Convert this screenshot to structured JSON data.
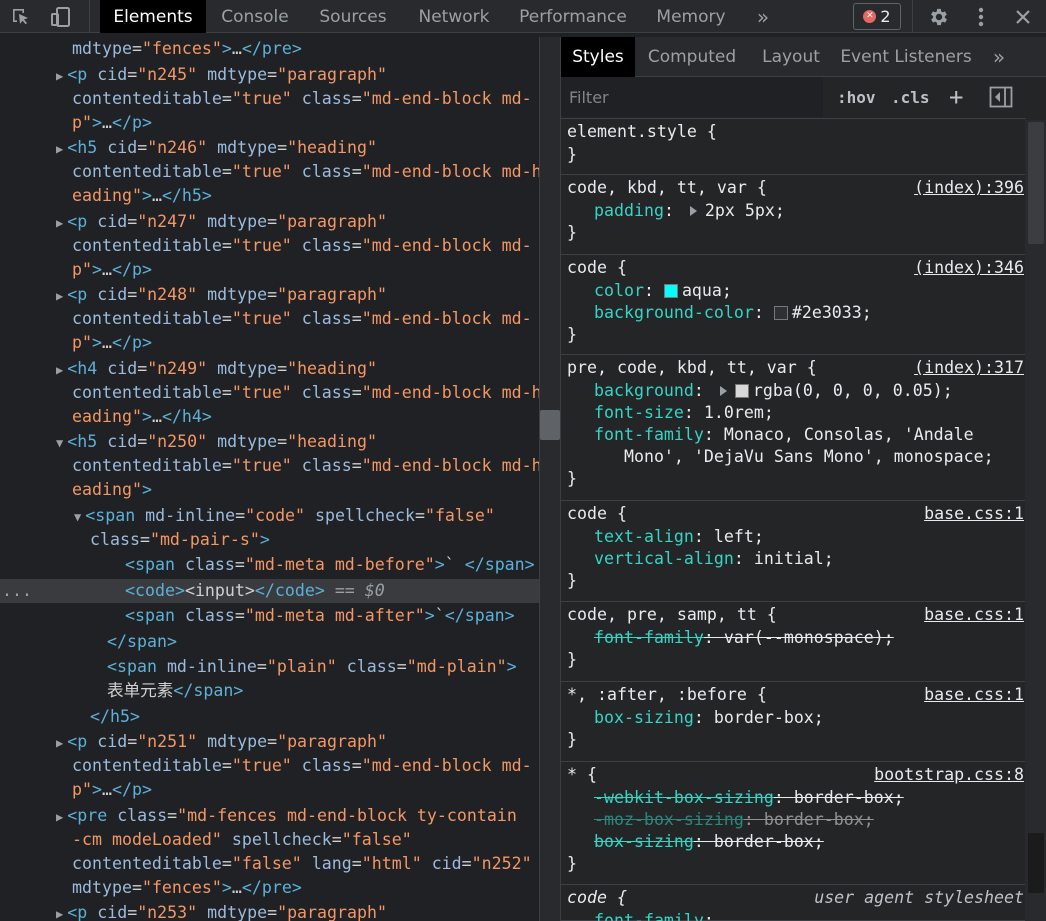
{
  "toolbar": {
    "tabs": [
      "Elements",
      "Console",
      "Sources",
      "Network",
      "Performance",
      "Memory"
    ],
    "more": "»",
    "error_count": "2",
    "icons": [
      "select-element-icon",
      "device-toolbar-icon",
      "gear-icon",
      "kebab-menu-icon",
      "close-icon"
    ]
  },
  "dom_lines": [
    [
      [
        "attr",
        "mdtype"
      ],
      [
        "txt",
        "="
      ],
      [
        "val",
        "\"fences\""
      ],
      [
        "tag",
        ">"
      ],
      [
        "txt",
        "…"
      ],
      [
        "tag",
        "</pre>"
      ]
    ],
    [
      [
        "tri",
        "▶"
      ],
      [
        "tag",
        "<p"
      ],
      [
        "attr",
        " cid"
      ],
      [
        "txt",
        "="
      ],
      [
        "val",
        "\"n245\""
      ],
      [
        "attr",
        " mdtype"
      ],
      [
        "txt",
        "="
      ],
      [
        "val",
        "\"paragraph\""
      ]
    ],
    [
      [
        "attr",
        "contenteditable"
      ],
      [
        "txt",
        "="
      ],
      [
        "val",
        "\"true\""
      ],
      [
        "attr",
        " class"
      ],
      [
        "txt",
        "="
      ],
      [
        "val",
        "\"md-end-block md-"
      ]
    ],
    [
      [
        "val",
        "p\""
      ],
      [
        "tag",
        ">"
      ],
      [
        "txt",
        "…"
      ],
      [
        "tag",
        "</p>"
      ]
    ],
    [
      [
        "tri",
        "▶"
      ],
      [
        "tag",
        "<h5"
      ],
      [
        "attr",
        " cid"
      ],
      [
        "txt",
        "="
      ],
      [
        "val",
        "\"n246\""
      ],
      [
        "attr",
        " mdtype"
      ],
      [
        "txt",
        "="
      ],
      [
        "val",
        "\"heading\""
      ]
    ],
    [
      [
        "attr",
        "contenteditable"
      ],
      [
        "txt",
        "="
      ],
      [
        "val",
        "\"true\""
      ],
      [
        "attr",
        " class"
      ],
      [
        "txt",
        "="
      ],
      [
        "val",
        "\"md-end-block md-h"
      ]
    ],
    [
      [
        "val",
        "eading\""
      ],
      [
        "tag",
        ">"
      ],
      [
        "txt",
        "…"
      ],
      [
        "tag",
        "</h5>"
      ]
    ],
    [
      [
        "tri",
        "▶"
      ],
      [
        "tag",
        "<p"
      ],
      [
        "attr",
        " cid"
      ],
      [
        "txt",
        "="
      ],
      [
        "val",
        "\"n247\""
      ],
      [
        "attr",
        " mdtype"
      ],
      [
        "txt",
        "="
      ],
      [
        "val",
        "\"paragraph\""
      ]
    ],
    [
      [
        "attr",
        "contenteditable"
      ],
      [
        "txt",
        "="
      ],
      [
        "val",
        "\"true\""
      ],
      [
        "attr",
        " class"
      ],
      [
        "txt",
        "="
      ],
      [
        "val",
        "\"md-end-block md-"
      ]
    ],
    [
      [
        "val",
        "p\""
      ],
      [
        "tag",
        ">"
      ],
      [
        "txt",
        "…"
      ],
      [
        "tag",
        "</p>"
      ]
    ],
    [
      [
        "tri",
        "▶"
      ],
      [
        "tag",
        "<p"
      ],
      [
        "attr",
        " cid"
      ],
      [
        "txt",
        "="
      ],
      [
        "val",
        "\"n248\""
      ],
      [
        "attr",
        " mdtype"
      ],
      [
        "txt",
        "="
      ],
      [
        "val",
        "\"paragraph\""
      ]
    ],
    [
      [
        "attr",
        "contenteditable"
      ],
      [
        "txt",
        "="
      ],
      [
        "val",
        "\"true\""
      ],
      [
        "attr",
        " class"
      ],
      [
        "txt",
        "="
      ],
      [
        "val",
        "\"md-end-block md-"
      ]
    ],
    [
      [
        "val",
        "p\""
      ],
      [
        "tag",
        ">"
      ],
      [
        "txt",
        "…"
      ],
      [
        "tag",
        "</p>"
      ]
    ],
    [
      [
        "tri",
        "▶"
      ],
      [
        "tag",
        "<h4"
      ],
      [
        "attr",
        " cid"
      ],
      [
        "txt",
        "="
      ],
      [
        "val",
        "\"n249\""
      ],
      [
        "attr",
        " mdtype"
      ],
      [
        "txt",
        "="
      ],
      [
        "val",
        "\"heading\""
      ]
    ],
    [
      [
        "attr",
        "contenteditable"
      ],
      [
        "txt",
        "="
      ],
      [
        "val",
        "\"true\""
      ],
      [
        "attr",
        " class"
      ],
      [
        "txt",
        "="
      ],
      [
        "val",
        "\"md-end-block md-h"
      ]
    ],
    [
      [
        "val",
        "eading\""
      ],
      [
        "tag",
        ">"
      ],
      [
        "txt",
        "…"
      ],
      [
        "tag",
        "</h4>"
      ]
    ],
    [
      [
        "tri",
        "▼"
      ],
      [
        "tag",
        "<h5"
      ],
      [
        "attr",
        " cid"
      ],
      [
        "txt",
        "="
      ],
      [
        "val",
        "\"n250\""
      ],
      [
        "attr",
        " mdtype"
      ],
      [
        "txt",
        "="
      ],
      [
        "val",
        "\"heading\""
      ]
    ],
    [
      [
        "attr",
        "contenteditable"
      ],
      [
        "txt",
        "="
      ],
      [
        "val",
        "\"true\""
      ],
      [
        "attr",
        " class"
      ],
      [
        "txt",
        "="
      ],
      [
        "val",
        "\"md-end-block md-h"
      ]
    ],
    [
      [
        "val",
        "eading\""
      ],
      [
        "tag",
        ">"
      ]
    ],
    [
      [
        "tri",
        "▼"
      ],
      [
        "tag",
        "<span"
      ],
      [
        "attr",
        " md-inline"
      ],
      [
        "txt",
        "="
      ],
      [
        "val",
        "\"code\""
      ],
      [
        "attr",
        " spellcheck"
      ],
      [
        "txt",
        "="
      ],
      [
        "val",
        "\"false\""
      ]
    ],
    [
      [
        "attr",
        "class"
      ],
      [
        "txt",
        "="
      ],
      [
        "val",
        "\"md-pair-s\""
      ],
      [
        "tag",
        ">"
      ]
    ],
    [
      [
        "tag",
        "<span"
      ],
      [
        "attr",
        " class"
      ],
      [
        "txt",
        "="
      ],
      [
        "val",
        "\"md-meta md-before\""
      ],
      [
        "tag",
        ">"
      ],
      [
        "txt",
        "` "
      ],
      [
        "tag",
        "</span>"
      ]
    ],
    [
      [
        "tag",
        "<code>"
      ],
      [
        "txt",
        "<input>"
      ],
      [
        "tag",
        "</code>"
      ],
      [
        "eq",
        " == $0"
      ]
    ],
    [
      [
        "tag",
        "<span"
      ],
      [
        "attr",
        " class"
      ],
      [
        "txt",
        "="
      ],
      [
        "val",
        "\"md-meta md-after\""
      ],
      [
        "tag",
        ">"
      ],
      [
        "txt",
        "`"
      ],
      [
        "tag",
        "</span>"
      ]
    ],
    [
      [
        "tag",
        "</span>"
      ]
    ],
    [
      [
        "tag",
        "<span"
      ],
      [
        "attr",
        " md-inline"
      ],
      [
        "txt",
        "="
      ],
      [
        "val",
        "\"plain\""
      ],
      [
        "attr",
        " class"
      ],
      [
        "txt",
        "="
      ],
      [
        "val",
        "\"md-plain\""
      ],
      [
        "tag",
        ">"
      ]
    ],
    [
      [
        "txt",
        "表单元素"
      ],
      [
        "tag",
        "</span>"
      ]
    ],
    [
      [
        "tag",
        "</h5>"
      ]
    ],
    [
      [
        "tri",
        "▶"
      ],
      [
        "tag",
        "<p"
      ],
      [
        "attr",
        " cid"
      ],
      [
        "txt",
        "="
      ],
      [
        "val",
        "\"n251\""
      ],
      [
        "attr",
        " mdtype"
      ],
      [
        "txt",
        "="
      ],
      [
        "val",
        "\"paragraph\""
      ]
    ],
    [
      [
        "attr",
        "contenteditable"
      ],
      [
        "txt",
        "="
      ],
      [
        "val",
        "\"true\""
      ],
      [
        "attr",
        " class"
      ],
      [
        "txt",
        "="
      ],
      [
        "val",
        "\"md-end-block md-"
      ]
    ],
    [
      [
        "val",
        "p\""
      ],
      [
        "tag",
        ">"
      ],
      [
        "txt",
        "…"
      ],
      [
        "tag",
        "</p>"
      ]
    ],
    [
      [
        "tri",
        "▶"
      ],
      [
        "tag",
        "<pre"
      ],
      [
        "attr",
        " class"
      ],
      [
        "txt",
        "="
      ],
      [
        "val",
        "\"md-fences md-end-block ty-contain"
      ]
    ],
    [
      [
        "val",
        "-cm modeLoaded\""
      ],
      [
        "attr",
        " spellcheck"
      ],
      [
        "txt",
        "="
      ],
      [
        "val",
        "\"false\""
      ]
    ],
    [
      [
        "attr",
        "contenteditable"
      ],
      [
        "txt",
        "="
      ],
      [
        "val",
        "\"false\""
      ],
      [
        "attr",
        " lang"
      ],
      [
        "txt",
        "="
      ],
      [
        "val",
        "\"html\""
      ],
      [
        "attr",
        " cid"
      ],
      [
        "txt",
        "="
      ],
      [
        "val",
        "\"n252\""
      ]
    ],
    [
      [
        "attr",
        "mdtype"
      ],
      [
        "txt",
        "="
      ],
      [
        "val",
        "\"fences\""
      ],
      [
        "tag",
        ">"
      ],
      [
        "txt",
        "…"
      ],
      [
        "tag",
        "</pre>"
      ]
    ],
    [
      [
        "tri",
        "▶"
      ],
      [
        "tag",
        "<p"
      ],
      [
        "attr",
        " cid"
      ],
      [
        "txt",
        "="
      ],
      [
        "val",
        "\"n253\""
      ],
      [
        "attr",
        " mdtype"
      ],
      [
        "txt",
        "="
      ],
      [
        "val",
        "\"paragraph\""
      ]
    ]
  ],
  "selected_line_index": 22,
  "selected_gutter": "...",
  "sidebar": {
    "tabs": [
      "Styles",
      "Computed",
      "Layout",
      "Event Listeners",
      "»"
    ],
    "filter_placeholder": "Filter",
    "hov": ":hov",
    "cls": ".cls",
    "plus": "+",
    "rules": [
      {
        "selector": "element.style {",
        "source": "",
        "props": [],
        "close": "}"
      },
      {
        "selector": "code, kbd, tt, var {",
        "source": "(index):396",
        "props": [
          {
            "name": "padding",
            "value": "2px 5px;",
            "arrow": true
          }
        ],
        "close": "}"
      },
      {
        "selector": "code {",
        "source": "(index):346",
        "props": [
          {
            "name": "color",
            "value": "aqua;",
            "swatch": "#00ffff"
          },
          {
            "name": "background-color",
            "value": "#2e3033;",
            "swatch": "#2e3033"
          }
        ],
        "close": "}"
      },
      {
        "selector": "pre, code, kbd, tt, var {",
        "source": "(index):317",
        "props": [
          {
            "name": "background",
            "value": "rgba(0, 0, 0, 0.05);",
            "arrow": true,
            "swatch": "#d8d8d8"
          },
          {
            "name": "font-size",
            "value": "1.0rem;"
          },
          {
            "name": "font-family",
            "value": "Monaco, Consolas, 'Andale",
            "cont": "   Mono', 'DejaVu Sans Mono', monospace;"
          }
        ],
        "close": "}"
      },
      {
        "selector": "code {",
        "source": "base.css:1",
        "props": [
          {
            "name": "text-align",
            "value": "left;"
          },
          {
            "name": "vertical-align",
            "value": "initial;"
          }
        ],
        "close": "}"
      },
      {
        "selector": "code, pre, samp, tt {",
        "source": "base.css:1",
        "props": [
          {
            "name": "font-family",
            "value": "var(--monospace);",
            "strike": true
          }
        ],
        "close": "}"
      },
      {
        "selector": "*, :after, :before {",
        "source": "base.css:1",
        "props": [
          {
            "name": "box-sizing",
            "value": "border-box;"
          }
        ],
        "close": "}"
      },
      {
        "selector": "* {",
        "source": "bootstrap.css:8",
        "props": [
          {
            "name": "-webkit-box-sizing",
            "value": "border-box;",
            "strike": true
          },
          {
            "name": "-moz-box-sizing",
            "value": "border-box;",
            "strike": true,
            "dim": true
          },
          {
            "name": "box-sizing",
            "value": "border-box;",
            "strike": true
          }
        ],
        "close": "}"
      },
      {
        "selector": "code {",
        "source": "user agent stylesheet",
        "ua": true,
        "props": [
          {
            "name": "font-family",
            "value": ""
          }
        ],
        "close": ""
      }
    ]
  }
}
